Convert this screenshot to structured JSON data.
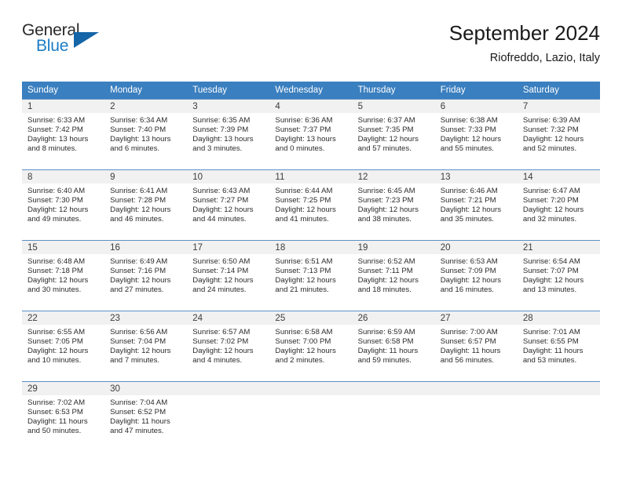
{
  "brand": {
    "name_part1": "General",
    "name_part2": "Blue",
    "color_dark": "#2a2a2a",
    "color_blue": "#1c7cc4",
    "triangle_color": "#1565a8"
  },
  "header": {
    "title": "September 2024",
    "subtitle": "Riofreddo, Lazio, Italy"
  },
  "theme": {
    "header_row_bg": "#3a7fbf",
    "header_row_text": "#ffffff",
    "daynum_band_bg": "#f1f1f1",
    "row_divider": "#5b91c6",
    "body_text": "#2b2b2b"
  },
  "columns": [
    "Sunday",
    "Monday",
    "Tuesday",
    "Wednesday",
    "Thursday",
    "Friday",
    "Saturday"
  ],
  "weeks": [
    [
      {
        "day": "1",
        "sunrise": "Sunrise: 6:33 AM",
        "sunset": "Sunset: 7:42 PM",
        "daylight1": "Daylight: 13 hours",
        "daylight2": "and 8 minutes."
      },
      {
        "day": "2",
        "sunrise": "Sunrise: 6:34 AM",
        "sunset": "Sunset: 7:40 PM",
        "daylight1": "Daylight: 13 hours",
        "daylight2": "and 6 minutes."
      },
      {
        "day": "3",
        "sunrise": "Sunrise: 6:35 AM",
        "sunset": "Sunset: 7:39 PM",
        "daylight1": "Daylight: 13 hours",
        "daylight2": "and 3 minutes."
      },
      {
        "day": "4",
        "sunrise": "Sunrise: 6:36 AM",
        "sunset": "Sunset: 7:37 PM",
        "daylight1": "Daylight: 13 hours",
        "daylight2": "and 0 minutes."
      },
      {
        "day": "5",
        "sunrise": "Sunrise: 6:37 AM",
        "sunset": "Sunset: 7:35 PM",
        "daylight1": "Daylight: 12 hours",
        "daylight2": "and 57 minutes."
      },
      {
        "day": "6",
        "sunrise": "Sunrise: 6:38 AM",
        "sunset": "Sunset: 7:33 PM",
        "daylight1": "Daylight: 12 hours",
        "daylight2": "and 55 minutes."
      },
      {
        "day": "7",
        "sunrise": "Sunrise: 6:39 AM",
        "sunset": "Sunset: 7:32 PM",
        "daylight1": "Daylight: 12 hours",
        "daylight2": "and 52 minutes."
      }
    ],
    [
      {
        "day": "8",
        "sunrise": "Sunrise: 6:40 AM",
        "sunset": "Sunset: 7:30 PM",
        "daylight1": "Daylight: 12 hours",
        "daylight2": "and 49 minutes."
      },
      {
        "day": "9",
        "sunrise": "Sunrise: 6:41 AM",
        "sunset": "Sunset: 7:28 PM",
        "daylight1": "Daylight: 12 hours",
        "daylight2": "and 46 minutes."
      },
      {
        "day": "10",
        "sunrise": "Sunrise: 6:43 AM",
        "sunset": "Sunset: 7:27 PM",
        "daylight1": "Daylight: 12 hours",
        "daylight2": "and 44 minutes."
      },
      {
        "day": "11",
        "sunrise": "Sunrise: 6:44 AM",
        "sunset": "Sunset: 7:25 PM",
        "daylight1": "Daylight: 12 hours",
        "daylight2": "and 41 minutes."
      },
      {
        "day": "12",
        "sunrise": "Sunrise: 6:45 AM",
        "sunset": "Sunset: 7:23 PM",
        "daylight1": "Daylight: 12 hours",
        "daylight2": "and 38 minutes."
      },
      {
        "day": "13",
        "sunrise": "Sunrise: 6:46 AM",
        "sunset": "Sunset: 7:21 PM",
        "daylight1": "Daylight: 12 hours",
        "daylight2": "and 35 minutes."
      },
      {
        "day": "14",
        "sunrise": "Sunrise: 6:47 AM",
        "sunset": "Sunset: 7:20 PM",
        "daylight1": "Daylight: 12 hours",
        "daylight2": "and 32 minutes."
      }
    ],
    [
      {
        "day": "15",
        "sunrise": "Sunrise: 6:48 AM",
        "sunset": "Sunset: 7:18 PM",
        "daylight1": "Daylight: 12 hours",
        "daylight2": "and 30 minutes."
      },
      {
        "day": "16",
        "sunrise": "Sunrise: 6:49 AM",
        "sunset": "Sunset: 7:16 PM",
        "daylight1": "Daylight: 12 hours",
        "daylight2": "and 27 minutes."
      },
      {
        "day": "17",
        "sunrise": "Sunrise: 6:50 AM",
        "sunset": "Sunset: 7:14 PM",
        "daylight1": "Daylight: 12 hours",
        "daylight2": "and 24 minutes."
      },
      {
        "day": "18",
        "sunrise": "Sunrise: 6:51 AM",
        "sunset": "Sunset: 7:13 PM",
        "daylight1": "Daylight: 12 hours",
        "daylight2": "and 21 minutes."
      },
      {
        "day": "19",
        "sunrise": "Sunrise: 6:52 AM",
        "sunset": "Sunset: 7:11 PM",
        "daylight1": "Daylight: 12 hours",
        "daylight2": "and 18 minutes."
      },
      {
        "day": "20",
        "sunrise": "Sunrise: 6:53 AM",
        "sunset": "Sunset: 7:09 PM",
        "daylight1": "Daylight: 12 hours",
        "daylight2": "and 16 minutes."
      },
      {
        "day": "21",
        "sunrise": "Sunrise: 6:54 AM",
        "sunset": "Sunset: 7:07 PM",
        "daylight1": "Daylight: 12 hours",
        "daylight2": "and 13 minutes."
      }
    ],
    [
      {
        "day": "22",
        "sunrise": "Sunrise: 6:55 AM",
        "sunset": "Sunset: 7:05 PM",
        "daylight1": "Daylight: 12 hours",
        "daylight2": "and 10 minutes."
      },
      {
        "day": "23",
        "sunrise": "Sunrise: 6:56 AM",
        "sunset": "Sunset: 7:04 PM",
        "daylight1": "Daylight: 12 hours",
        "daylight2": "and 7 minutes."
      },
      {
        "day": "24",
        "sunrise": "Sunrise: 6:57 AM",
        "sunset": "Sunset: 7:02 PM",
        "daylight1": "Daylight: 12 hours",
        "daylight2": "and 4 minutes."
      },
      {
        "day": "25",
        "sunrise": "Sunrise: 6:58 AM",
        "sunset": "Sunset: 7:00 PM",
        "daylight1": "Daylight: 12 hours",
        "daylight2": "and 2 minutes."
      },
      {
        "day": "26",
        "sunrise": "Sunrise: 6:59 AM",
        "sunset": "Sunset: 6:58 PM",
        "daylight1": "Daylight: 11 hours",
        "daylight2": "and 59 minutes."
      },
      {
        "day": "27",
        "sunrise": "Sunrise: 7:00 AM",
        "sunset": "Sunset: 6:57 PM",
        "daylight1": "Daylight: 11 hours",
        "daylight2": "and 56 minutes."
      },
      {
        "day": "28",
        "sunrise": "Sunrise: 7:01 AM",
        "sunset": "Sunset: 6:55 PM",
        "daylight1": "Daylight: 11 hours",
        "daylight2": "and 53 minutes."
      }
    ],
    [
      {
        "day": "29",
        "sunrise": "Sunrise: 7:02 AM",
        "sunset": "Sunset: 6:53 PM",
        "daylight1": "Daylight: 11 hours",
        "daylight2": "and 50 minutes."
      },
      {
        "day": "30",
        "sunrise": "Sunrise: 7:04 AM",
        "sunset": "Sunset: 6:52 PM",
        "daylight1": "Daylight: 11 hours",
        "daylight2": "and 47 minutes."
      },
      {
        "day": "",
        "sunrise": "",
        "sunset": "",
        "daylight1": "",
        "daylight2": ""
      },
      {
        "day": "",
        "sunrise": "",
        "sunset": "",
        "daylight1": "",
        "daylight2": ""
      },
      {
        "day": "",
        "sunrise": "",
        "sunset": "",
        "daylight1": "",
        "daylight2": ""
      },
      {
        "day": "",
        "sunrise": "",
        "sunset": "",
        "daylight1": "",
        "daylight2": ""
      },
      {
        "day": "",
        "sunrise": "",
        "sunset": "",
        "daylight1": "",
        "daylight2": ""
      }
    ]
  ]
}
